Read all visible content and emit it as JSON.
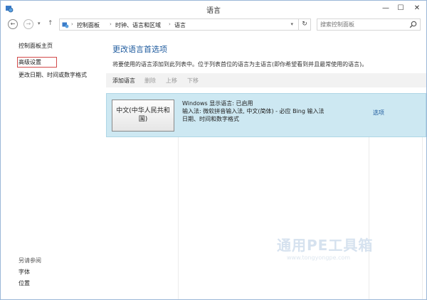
{
  "window": {
    "title": "语言",
    "controls": {
      "minimize": "—",
      "maximize": "☐",
      "close": "✕"
    }
  },
  "address": {
    "back": "←",
    "forward": "→",
    "history": "▾",
    "up": "↑",
    "breadcrumbs": [
      "控制面板",
      "时钟、语言和区域",
      "语言"
    ],
    "separator": "›",
    "dropdown": "▾",
    "refresh": "↻",
    "search_placeholder": "搜索控制面板"
  },
  "sidebar": {
    "items": [
      {
        "label": "控制面板主页"
      },
      {
        "label": "高级设置"
      },
      {
        "label": "更改日期、时间或数字格式"
      }
    ],
    "see_also_title": "另请参阅",
    "see_also": [
      {
        "label": "字体"
      },
      {
        "label": "位置"
      }
    ]
  },
  "main": {
    "heading": "更改语言首选项",
    "description": "将要使用的语言添加到此列表中。位于列表首位的语言为主语言(即你希望看到并且最常使用的语言)。",
    "toolbar": {
      "add": "添加语言",
      "remove": "删除",
      "move_up": "上移",
      "move_down": "下移"
    },
    "languages": [
      {
        "tile": "中文(中华人民共和国)",
        "lines": [
          "Windows 显示语言: 已启用",
          "输入法: 微软拼音输入法, 中文(简体) - 必应 Bing 输入法",
          "日期、时间和数字格式"
        ],
        "options": "选项"
      }
    ]
  },
  "watermark": {
    "title": "通用PE工具箱",
    "url": "www.tongyongpe.com"
  },
  "colors": {
    "link": "#1f5b9e",
    "selection": "#cde8f2",
    "highlight_box": "#d24a4a"
  }
}
